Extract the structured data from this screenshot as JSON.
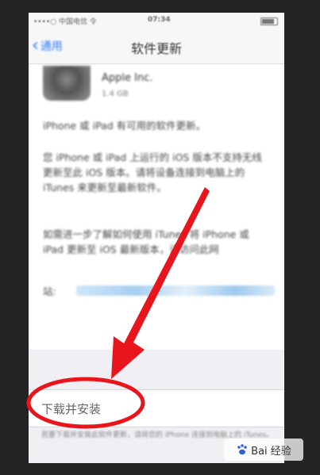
{
  "status_bar": {
    "carrier": "••••○ 中国电信 令",
    "time": "07:34"
  },
  "nav": {
    "back_label": "通用",
    "title": "软件更新"
  },
  "update": {
    "publisher": "Apple Inc.",
    "size": "1.4 GB",
    "paragraphs": [
      "iPhone 或 iPad 有可用的软件更新。",
      "您 iPhone 或 iPad 上运行的 iOS 版本不支持无线更新至此 iOS 版本。请将设备连接到电脑上的 iTunes 来更新至最新软件。",
      "如需进一步了解如何使用 iTunes 将 iPhone 或 iPad 更新至 iOS 最新版本，请访问此网"
    ],
    "link_prefix": "站:"
  },
  "download": {
    "label": "下载并安装"
  },
  "footnote": "若要下载并安装此软件更新，请将您的 iPhone 连接到电脑上的 iTunes。",
  "watermark": {
    "text": "Bai 经验"
  },
  "colors": {
    "accent": "#2f7cf6",
    "annotation": "#e8151c"
  }
}
